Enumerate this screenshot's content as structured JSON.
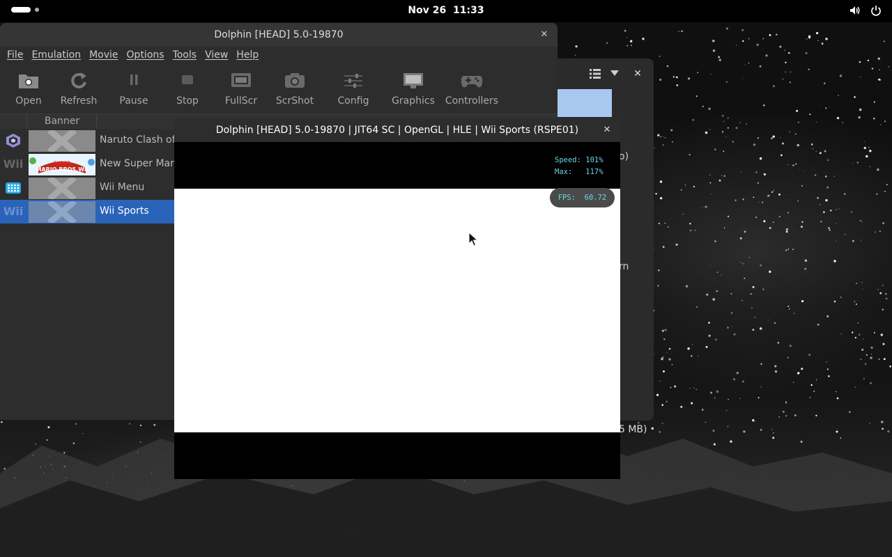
{
  "topbar": {
    "date": "Nov 26",
    "time": "11:33",
    "icons": [
      "volume-icon",
      "power-icon"
    ]
  },
  "background_window": {
    "icons": [
      "list-view-icon",
      "dropdown-arrow-icon",
      "close-icon"
    ],
    "fragment_1": "o)",
    "fragment_2": "rn",
    "fragment_3": "5 MB)"
  },
  "main_window": {
    "title": "Dolphin [HEAD] 5.0-19870",
    "close_symbol": "✕",
    "menus": [
      "File",
      "Emulation",
      "Movie",
      "Options",
      "Tools",
      "View",
      "Help"
    ],
    "toolbar": [
      {
        "label": "Open",
        "icon": "open-folder-icon"
      },
      {
        "label": "Refresh",
        "icon": "refresh-icon"
      },
      {
        "label": "Pause",
        "icon": "pause-icon"
      },
      {
        "label": "Stop",
        "icon": "stop-icon"
      },
      {
        "label": "FullScr",
        "icon": "fullscreen-icon"
      },
      {
        "label": "ScrShot",
        "icon": "camera-icon"
      },
      {
        "label": "Config",
        "icon": "sliders-icon"
      },
      {
        "label": "Graphics",
        "icon": "monitor-icon"
      },
      {
        "label": "Controllers",
        "icon": "gamepad-icon"
      }
    ],
    "columns": {
      "banner": "Banner"
    },
    "games": [
      {
        "platform": "gamecube",
        "platform_label": "",
        "title": "Naruto Clash of",
        "banner": "placeholder",
        "selected": false
      },
      {
        "platform": "wii",
        "platform_label": "Wii",
        "title": "New Super Mari",
        "banner": "New Super Mario Bros. Wii",
        "selected": false
      },
      {
        "platform": "wiiware",
        "platform_label": "",
        "title": "Wii Menu",
        "banner": "placeholder",
        "selected": false
      },
      {
        "platform": "wii",
        "platform_label": "Wii",
        "title": "Wii Sports",
        "banner": "placeholder",
        "selected": true
      }
    ]
  },
  "render_window": {
    "title": "Dolphin [HEAD] 5.0-19870 | JIT64 SC | OpenGL | HLE | Wii Sports (RSPE01)",
    "close_symbol": "✕",
    "speed_line": "Speed: 101%",
    "max_line": "Max:   117%",
    "fps_line": "FPS:  60.72"
  },
  "colors": {
    "selection": "#2a64b8",
    "osd_text": "#6fd3e8",
    "window_bg": "#2d2d2d"
  }
}
